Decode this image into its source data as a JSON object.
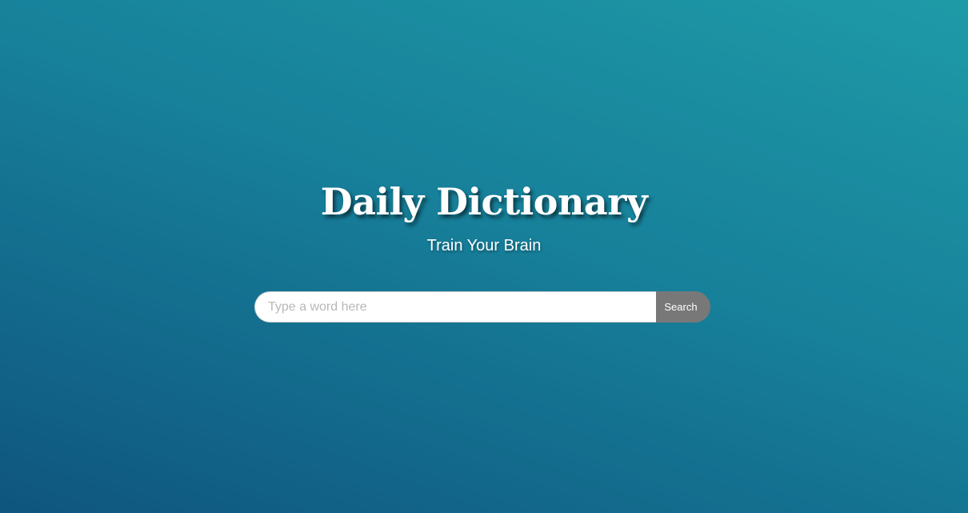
{
  "hero": {
    "title": "Daily Dictionary",
    "subtitle": "Train Your Brain"
  },
  "search": {
    "placeholder": "Type a word here",
    "value": "",
    "button_label": "Search"
  },
  "colors": {
    "background_top": "#1e9aa7",
    "background_bottom": "#0f557e",
    "button": "#787878",
    "text": "#ffffff"
  }
}
